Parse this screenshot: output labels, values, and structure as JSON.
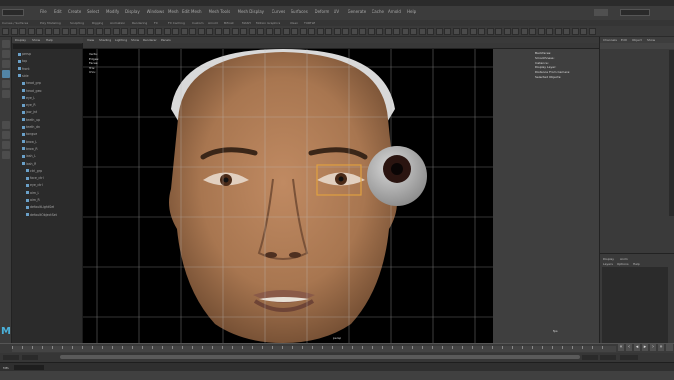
{
  "app": {
    "logo_letter": "M",
    "menu_items": [
      "File",
      "Edit",
      "Create",
      "Select",
      "Modify",
      "Display",
      "Windows",
      "Mesh",
      "Edit Mesh",
      "Mesh Tools",
      "Mesh Display",
      "Curves",
      "Surfaces",
      "Deform",
      "UV",
      "Generate",
      "Cache",
      "Arnold",
      "Help"
    ],
    "mode_selector": "Modeling",
    "workspace_selector": "Maya Classic"
  },
  "shelf": {
    "tabs": [
      "Curves / Surfaces",
      "Poly Modeling",
      "Sculpting",
      "Rigging",
      "Animation",
      "Rendering",
      "FX",
      "FX Caching",
      "Custom",
      "Arnold",
      "Bifrost",
      "MASH",
      "Motion Graphics",
      "XGen",
      "TURTLE"
    ]
  },
  "outliner": {
    "menu": [
      "Display",
      "Show",
      "Help"
    ],
    "search_placeholder": "",
    "items": [
      "persp",
      "top",
      "front",
      "side",
      "head_grp",
      "head_geo",
      "eye_L",
      "eye_R",
      "jaw_jnt",
      "teeth_up",
      "teeth_dn",
      "tongue",
      "brow_L",
      "brow_R",
      "lash_L",
      "lash_R",
      "ctrl_grp",
      "face_ctrl",
      "eye_ctrl",
      "aim_L",
      "aim_R",
      "defaultLightSet",
      "defaultObjectSet"
    ]
  },
  "viewport": {
    "menu": [
      "View",
      "Shading",
      "Lighting",
      "Show",
      "Renderer",
      "Panels"
    ],
    "hud_left": [
      "Verts:",
      "Edges:",
      "Faces:",
      "Tris:",
      "UVs:"
    ],
    "hud_right": [
      "Backfaces:",
      "Smoothness:",
      "Instance:",
      "Display Layer:",
      "Distance From Camera:",
      "Selected Objects:"
    ],
    "camera_label": "persp",
    "fps_label": "fps"
  },
  "channel_box": {
    "tabs": [
      "Channels",
      "Edit",
      "Object",
      "Show"
    ]
  },
  "layer_editor": {
    "tabs": [
      "Display",
      "Anim"
    ],
    "menu": [
      "Layers",
      "Options",
      "Help"
    ]
  },
  "timeline": {
    "start_frame": "1",
    "end_frame": "120",
    "current_frame": "1",
    "range_start": "1",
    "range_end": "200",
    "fps_option": "24 fps"
  },
  "command_line": {
    "label": "MEL"
  },
  "colors": {
    "accent": "#5285a6",
    "face_skin": "#a87650",
    "grid_line": "#bfbfbf",
    "selection": "#e0a040"
  }
}
